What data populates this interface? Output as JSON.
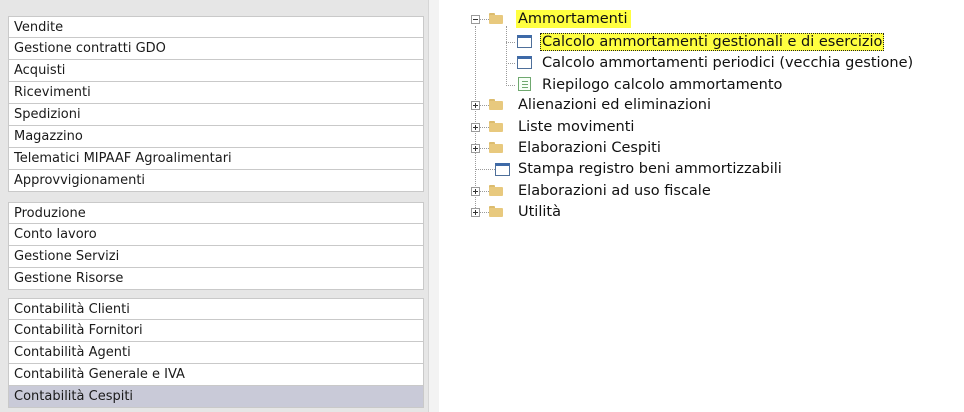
{
  "modules": {
    "group1": [
      "Vendite",
      "Gestione contratti GDO",
      "Acquisti",
      "Ricevimenti",
      "Spedizioni",
      "Magazzino",
      "Telematici MIPAAF Agroalimentari",
      "Approvvigionamenti"
    ],
    "group2": [
      "Produzione",
      "Conto lavoro",
      "Gestione Servizi",
      "Gestione Risorse"
    ],
    "group3": [
      "Contabilità Clienti",
      "Contabilità Fornitori",
      "Contabilità Agenti",
      "Contabilità Generale e IVA",
      "Contabilità Cespiti"
    ],
    "selected": "Contabilità Cespiti"
  },
  "tree": {
    "ammortamenti": {
      "label": "Ammortamenti",
      "children": {
        "calcolo_gestionali": "Calcolo ammortamenti gestionali e di esercizio",
        "calcolo_periodici": "Calcolo ammortamenti periodici (vecchia gestione)",
        "riepilogo": "Riepilogo calcolo ammortamento"
      }
    },
    "alienazioni": "Alienazioni ed eliminazioni",
    "liste_movimenti": "Liste movimenti",
    "elaborazioni_cespiti": "Elaborazioni Cespiti",
    "stampa_registro": "Stampa registro beni ammortizzabili",
    "elaborazioni_fiscale": "Elaborazioni ad uso fiscale",
    "utilita": "Utilità"
  },
  "colors": {
    "highlight": "#ffff40",
    "selected_module": "#c9cad8",
    "panel_bg": "#e6e6e6"
  }
}
